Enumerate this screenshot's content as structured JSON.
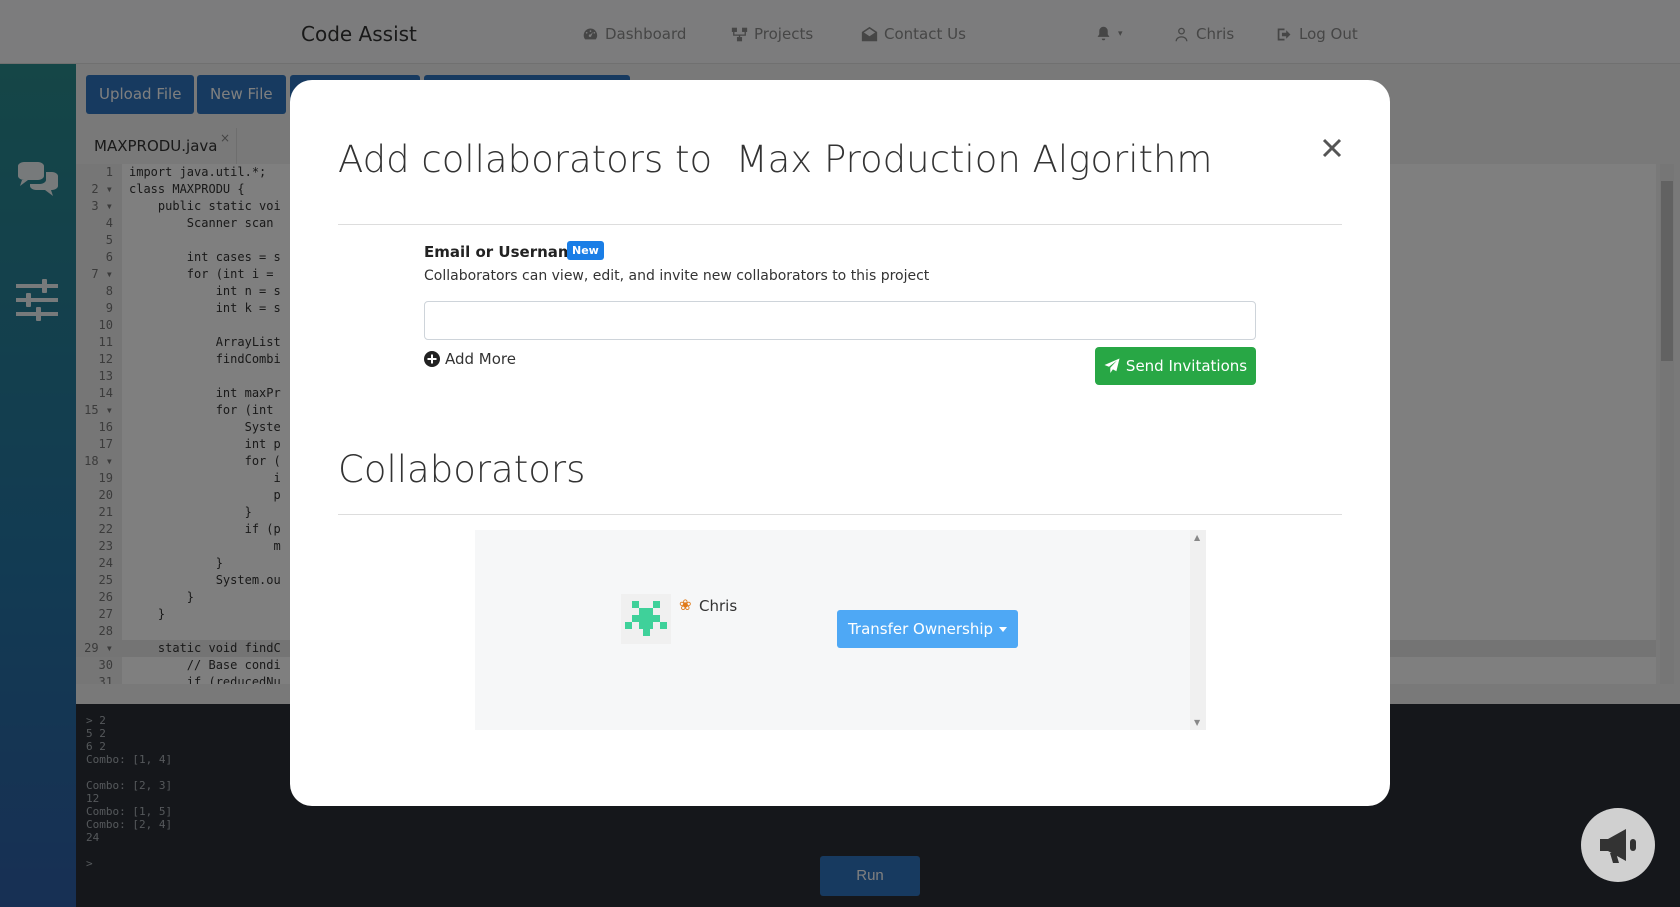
{
  "app": {
    "brand": "Code Assist"
  },
  "nav": {
    "dashboard": "Dashboard",
    "projects": "Projects",
    "contact": "Contact Us",
    "user": "Chris",
    "logout": "Log Out"
  },
  "toolbar": {
    "upload": "Upload File",
    "new_file": "New File"
  },
  "editor": {
    "tab": "MAXPRODU.java",
    "lines": [
      {
        "n": "1",
        "t": "import java.util.*;"
      },
      {
        "n": "2 ▾",
        "t": "class MAXPRODU {"
      },
      {
        "n": "3 ▾",
        "t": "    public static voi"
      },
      {
        "n": "4",
        "t": "        Scanner scan"
      },
      {
        "n": "5",
        "t": ""
      },
      {
        "n": "6",
        "t": "        int cases = s"
      },
      {
        "n": "7 ▾",
        "t": "        for (int i ="
      },
      {
        "n": "8",
        "t": "            int n = s"
      },
      {
        "n": "9",
        "t": "            int k = s"
      },
      {
        "n": "10",
        "t": ""
      },
      {
        "n": "11",
        "t": "            ArrayList"
      },
      {
        "n": "12",
        "t": "            findCombi"
      },
      {
        "n": "13",
        "t": ""
      },
      {
        "n": "14",
        "t": "            int maxPr"
      },
      {
        "n": "15 ▾",
        "t": "            for (int"
      },
      {
        "n": "16",
        "t": "                Syste"
      },
      {
        "n": "17",
        "t": "                int p"
      },
      {
        "n": "18 ▾",
        "t": "                for ("
      },
      {
        "n": "19",
        "t": "                    i"
      },
      {
        "n": "20",
        "t": "                    p"
      },
      {
        "n": "21",
        "t": "                }"
      },
      {
        "n": "22",
        "t": "                if (p"
      },
      {
        "n": "23",
        "t": "                    m"
      },
      {
        "n": "24",
        "t": "            }"
      },
      {
        "n": "25",
        "t": "            System.ou"
      },
      {
        "n": "26",
        "t": "        }"
      },
      {
        "n": "27",
        "t": "    }"
      },
      {
        "n": "28",
        "t": ""
      },
      {
        "n": "29 ▾",
        "t": "    static void findC"
      },
      {
        "n": "30",
        "t": "        // Base condi"
      },
      {
        "n": "31",
        "t": "        if (reducedNu"
      }
    ]
  },
  "console": {
    "lines": [
      "> 2",
      "5 2",
      "6 2",
      "Combo: [1, 4]",
      "",
      "Combo: [2, 3]",
      "12",
      "Combo: [1, 5]",
      "Combo: [2, 4]",
      "24",
      "",
      ">"
    ],
    "run": "Run"
  },
  "modal": {
    "title_prefix": "Add collaborators to",
    "project_name": "Max Production Algorithm",
    "field_label": "Email or Username",
    "badge": "New",
    "help": "Collaborators can view, edit, and invite new collaborators to this project",
    "input_value": "",
    "add_more": "Add More",
    "send": "Send Invitations",
    "section_title": "Collaborators",
    "collaborator": {
      "name": "Chris",
      "role_icon": "medal-icon"
    },
    "transfer": "Transfer Ownership"
  },
  "colors": {
    "primary": "#2f75c0",
    "success": "#28a745",
    "info": "#4ea8f5",
    "badge": "#1a7ee6"
  }
}
